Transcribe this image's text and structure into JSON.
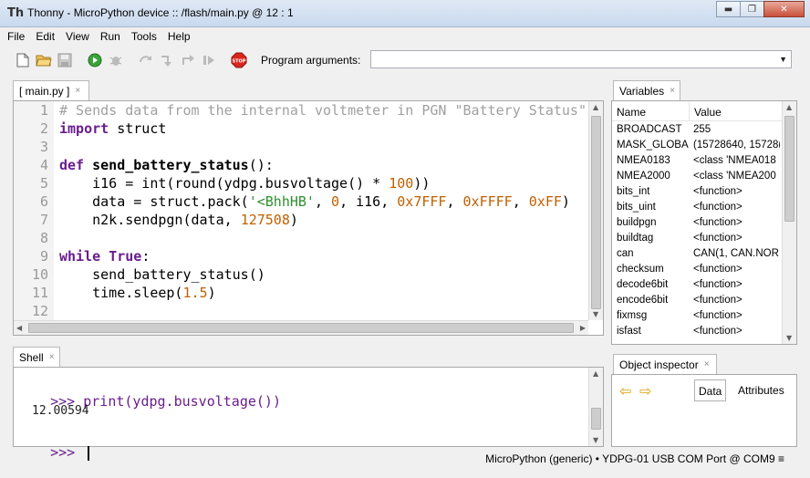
{
  "window": {
    "app_icon": "Th",
    "title": "Thonny  -  MicroPython device :: /flash/main.py  @  12 : 1",
    "minimize": "▬",
    "maximize": "❐",
    "close": "✕"
  },
  "menu": [
    "File",
    "Edit",
    "View",
    "Run",
    "Tools",
    "Help"
  ],
  "toolbar": {
    "icons": [
      "new-file-icon",
      "open-file-icon",
      "save-icon",
      "run-icon",
      "debug-icon",
      "step-over-icon",
      "step-into-icon",
      "step-out-icon",
      "resume-icon",
      "stop-icon"
    ],
    "program_arguments_label": "Program arguments:",
    "program_arguments_value": ""
  },
  "editor": {
    "tab_label": "[ main.py ]",
    "tab_close": "×",
    "line_numbers": [
      "1",
      "2",
      "3",
      "4",
      "5",
      "6",
      "7",
      "8",
      "9",
      "10",
      "11",
      "12"
    ]
  },
  "shell": {
    "tab_label": "Shell",
    "tab_close": "×",
    "prompt": ">>>",
    "command": "print(ydpg.busvoltage())",
    "output": "12.00594",
    "prompt2": ">>>"
  },
  "variables": {
    "tab_label": "Variables",
    "tab_close": "×",
    "col_name": "Name",
    "col_value": "Value",
    "rows": [
      {
        "name": "BROADCAST",
        "value": "255"
      },
      {
        "name": "MASK_GLOBA",
        "value": "(15728640, 15728("
      },
      {
        "name": "NMEA0183",
        "value": "<class 'NMEA018"
      },
      {
        "name": "NMEA2000",
        "value": "<class 'NMEA200"
      },
      {
        "name": "bits_int",
        "value": "<function>"
      },
      {
        "name": "bits_uint",
        "value": "<function>"
      },
      {
        "name": "buildpgn",
        "value": "<function>"
      },
      {
        "name": "buildtag",
        "value": "<function>"
      },
      {
        "name": "can",
        "value": "CAN(1, CAN.NOR"
      },
      {
        "name": "checksum",
        "value": "<function>"
      },
      {
        "name": "decode6bit",
        "value": "<function>"
      },
      {
        "name": "encode6bit",
        "value": "<function>"
      },
      {
        "name": "fixmsg",
        "value": "<function>"
      },
      {
        "name": "isfast",
        "value": "<function>"
      }
    ]
  },
  "inspector": {
    "tab_label": "Object inspector",
    "tab_close": "×",
    "back": "⇦",
    "forward": "⇨",
    "data_tab": "Data",
    "attributes_tab": "Attributes"
  },
  "status": {
    "interpreter": "MicroPython (generic)  •  YDPG-01 USB COM Port @ COM9  ≡"
  },
  "colors": {
    "keyword": "#6a1d8c",
    "comment": "#a0a0a0",
    "string": "#2f8f2f",
    "number": "#c06000"
  }
}
